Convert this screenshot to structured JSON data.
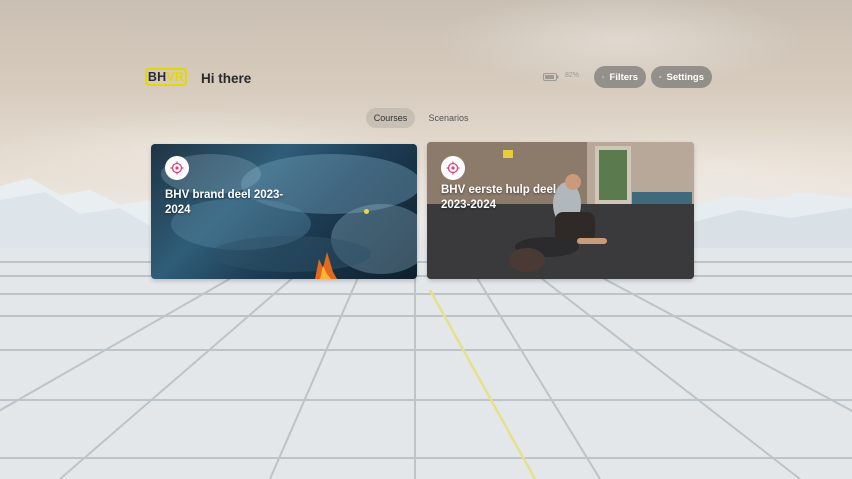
{
  "header": {
    "logo": {
      "left": "BH",
      "right": "VR"
    },
    "greeting": "Hi there",
    "battery_percent": "82%",
    "filters_label": "Filters",
    "settings_label": "Settings"
  },
  "tabs": [
    {
      "label": "Courses",
      "active": true
    },
    {
      "label": "Scenarios",
      "active": false
    }
  ],
  "courses": [
    {
      "title": "BHV brand deel 2023-2024",
      "icon": "target-icon"
    },
    {
      "title": "BHV eerste hulp deel 2023-2024",
      "icon": "target-icon"
    }
  ],
  "colors": {
    "brand_yellow": "#e4d800",
    "icon_pink": "#e0407a",
    "pill_bg": "#6e6e6e"
  }
}
